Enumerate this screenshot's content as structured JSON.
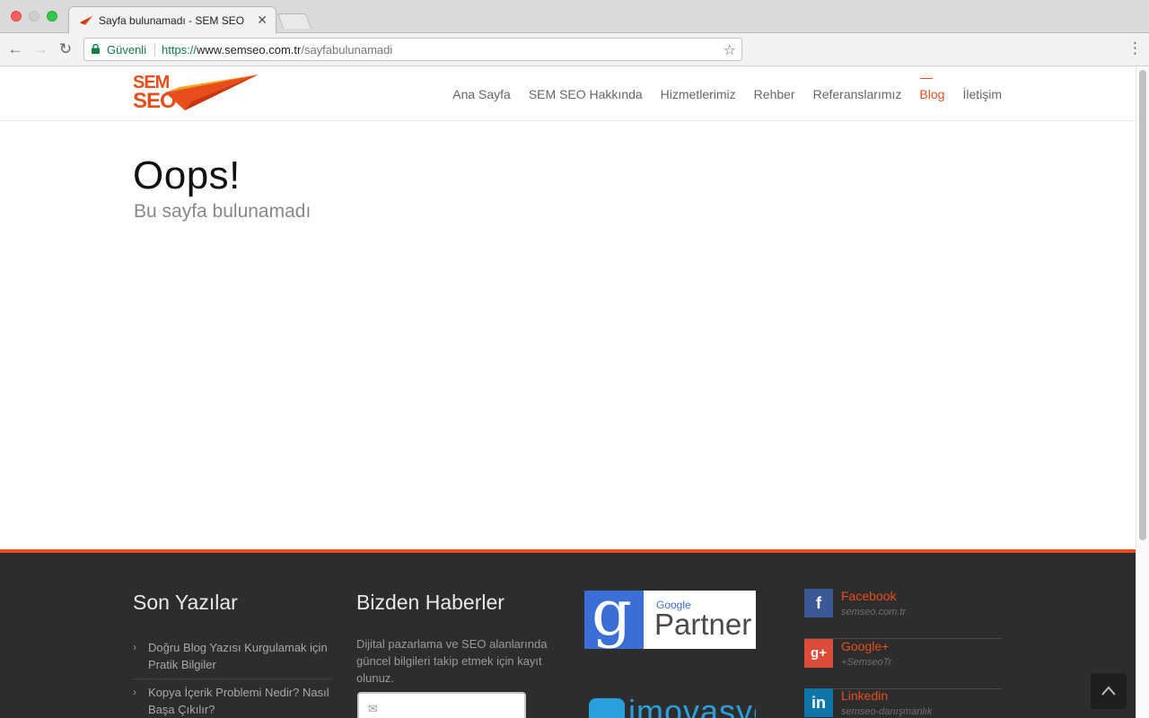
{
  "browser": {
    "tab_title": "Sayfa bulunamadı - SEM SEO",
    "tab_close": "✕",
    "secure_label": "Güvenli",
    "url_scheme": "https://",
    "url_host": "www.semseo.com.tr",
    "url_path": "/sayfabulunamadi"
  },
  "site": {
    "logo_line1": "SEM",
    "logo_line2": "SEO",
    "nav": [
      "Ana Sayfa",
      "SEM SEO Hakkında",
      "Hizmetlerimiz",
      "Rehber",
      "Referanslarımız",
      "Blog",
      "İletişim"
    ],
    "nav_active": "Blog",
    "accent_color": "#e84e1b"
  },
  "main": {
    "title": "Oops!",
    "subtitle": "Bu sayfa bulunamadı"
  },
  "footer": {
    "recent_title": "Son Yazılar",
    "recent_posts": [
      "Doğru Blog Yazısı Kurgulamak için Pratik Bilgiler",
      "Kopya İçerik Problemi Nedir? Nasıl Başa Çıkılır?"
    ],
    "news_title": "Bizden Haberler",
    "news_text": "Dijital pazarlama ve SEO alanlarında güncel bilgileri takip etmek için kayıt olunuz.",
    "google_partner": {
      "google": "Google",
      "partner": "Partner"
    },
    "imovasyon": "imovasyon",
    "social": [
      {
        "name": "Facebook",
        "handle": "semseo.com.tr",
        "icon": "facebook-icon",
        "glyph": "f"
      },
      {
        "name": "Google+",
        "handle": "+SemseoTr",
        "icon": "google-plus-icon",
        "glyph": "g+"
      },
      {
        "name": "Linkedin",
        "handle": "semseo-danışmanlık",
        "icon": "linkedin-icon",
        "glyph": "in"
      }
    ]
  }
}
